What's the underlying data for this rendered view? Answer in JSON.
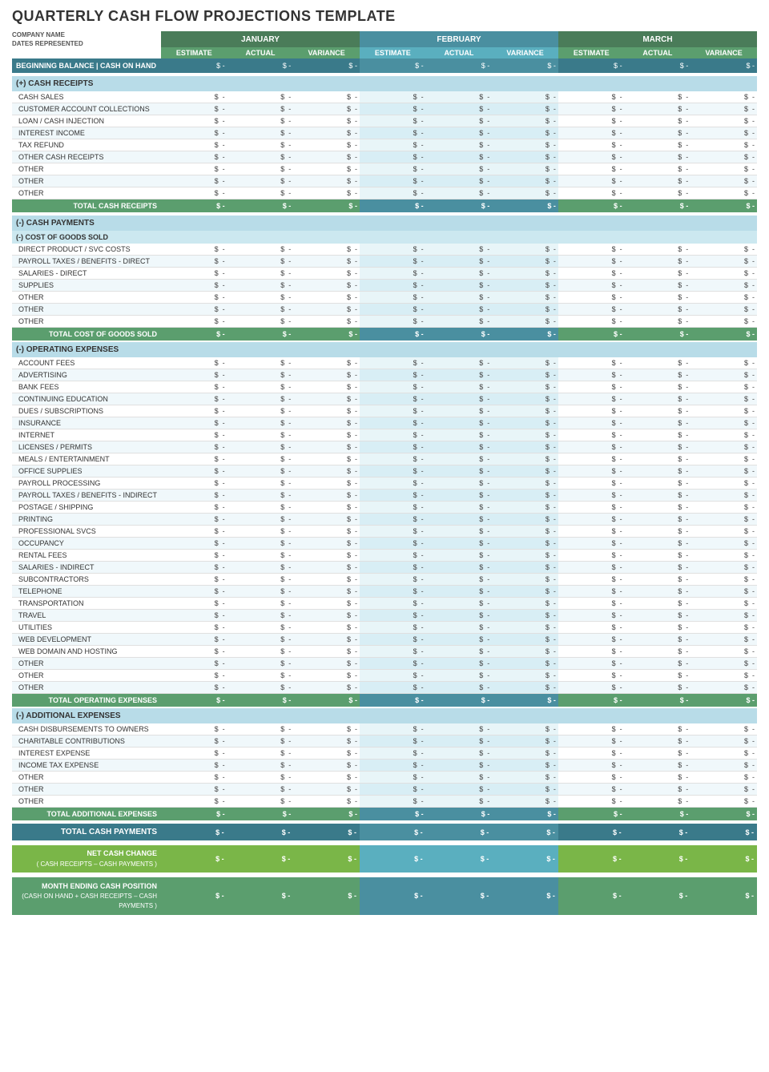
{
  "title": "QUARTERLY CASH FLOW PROJECTIONS TEMPLATE",
  "company": {
    "name_label": "COMPANY NAME",
    "dates_label": "DATES REPRESENTED"
  },
  "months": [
    {
      "label": "JANUARY"
    },
    {
      "label": "FEBRUARY"
    },
    {
      "label": "MARCH"
    }
  ],
  "sub_headers": [
    "ESTIMATE",
    "ACTUAL",
    "VARIANCE"
  ],
  "beginning_balance": {
    "label": "BEGINNING BALANCE | CASH ON HAND"
  },
  "cash_receipts": {
    "section_label": "(+) CASH RECEIPTS",
    "items": [
      "CASH SALES",
      "CUSTOMER ACCOUNT COLLECTIONS",
      "LOAN / CASH INJECTION",
      "INTEREST INCOME",
      "TAX REFUND",
      "OTHER CASH RECEIPTS",
      "OTHER",
      "OTHER",
      "OTHER"
    ],
    "total_label": "TOTAL CASH RECEIPTS"
  },
  "cash_payments": {
    "section_label": "(-) CASH PAYMENTS",
    "cogs": {
      "section_label": "(-) COST OF GOODS SOLD",
      "items": [
        "DIRECT PRODUCT / SVC COSTS",
        "PAYROLL TAXES / BENEFITS - DIRECT",
        "SALARIES - DIRECT",
        "SUPPLIES",
        "OTHER",
        "OTHER",
        "OTHER"
      ],
      "total_label": "TOTAL COST OF GOODS SOLD"
    },
    "operating": {
      "section_label": "(-) OPERATING EXPENSES",
      "items": [
        "ACCOUNT FEES",
        "ADVERTISING",
        "BANK FEES",
        "CONTINUING EDUCATION",
        "DUES / SUBSCRIPTIONS",
        "INSURANCE",
        "INTERNET",
        "LICENSES / PERMITS",
        "MEALS / ENTERTAINMENT",
        "OFFICE SUPPLIES",
        "PAYROLL PROCESSING",
        "PAYROLL TAXES / BENEFITS - INDIRECT",
        "POSTAGE / SHIPPING",
        "PRINTING",
        "PROFESSIONAL SVCS",
        "OCCUPANCY",
        "RENTAL FEES",
        "SALARIES - INDIRECT",
        "SUBCONTRACTORS",
        "TELEPHONE",
        "TRANSPORTATION",
        "TRAVEL",
        "UTILITIES",
        "WEB DEVELOPMENT",
        "WEB DOMAIN AND HOSTING",
        "OTHER",
        "OTHER",
        "OTHER"
      ],
      "total_label": "TOTAL OPERATING EXPENSES"
    },
    "additional": {
      "section_label": "(-) ADDITIONAL EXPENSES",
      "items": [
        "CASH DISBURSEMENTS TO OWNERS",
        "CHARITABLE CONTRIBUTIONS",
        "INTEREST EXPENSE",
        "INCOME TAX EXPENSE",
        "OTHER",
        "OTHER",
        "OTHER"
      ],
      "total_label": "TOTAL ADDITIONAL EXPENSES"
    },
    "total_label": "TOTAL CASH PAYMENTS"
  },
  "net_cash_change": {
    "label": "NET CASH CHANGE",
    "sublabel": "( CASH RECEIPTS – CASH PAYMENTS )"
  },
  "month_ending": {
    "label": "MONTH ENDING CASH POSITION",
    "sublabel": "(CASH ON HAND + CASH RECEIPTS – CASH PAYMENTS )"
  },
  "dollar_sign": "$",
  "dash": "-"
}
